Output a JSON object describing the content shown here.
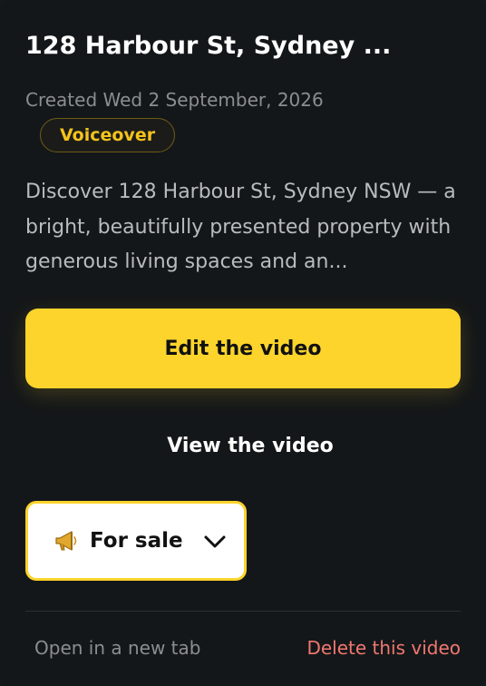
{
  "card": {
    "title": "128 Harbour St, Sydney ...",
    "created": "Created Wed 2 September, 2026",
    "badge": "Voiceover",
    "description": "Discover 128 Harbour St, Sydney NSW — a bright, beautifully presented property with generous living spaces and an...",
    "edit_button_label": "Edit the video",
    "view_link_label": "View the video",
    "status": {
      "icon": "megaphone-icon",
      "selected": "For sale"
    },
    "footer": {
      "open_tab_label": "Open in a new tab",
      "delete_label": "Delete this video"
    }
  },
  "colors": {
    "background": "#141719",
    "accent": "#fdd42b",
    "badge_text": "#f4c21c",
    "muted_text": "#8b8e91",
    "danger": "#f07870"
  }
}
